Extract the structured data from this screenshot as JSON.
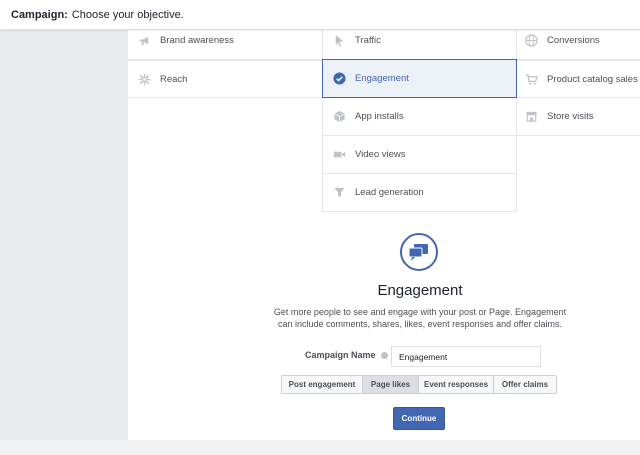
{
  "header": {
    "bold": "Campaign:",
    "text": "Choose your objective."
  },
  "objectives": {
    "brand_awareness": "Brand awareness",
    "reach": "Reach",
    "traffic": "Traffic",
    "engagement": "Engagement",
    "app_installs": "App installs",
    "video_views": "Video views",
    "lead_generation": "Lead generation",
    "conversions": "Conversions",
    "product_catalog_sales": "Product catalog sales",
    "store_visits": "Store visits"
  },
  "detail": {
    "title": "Engagement",
    "description": "Get more people to see and engage with your post or Page. Engagement can include comments, shares, likes, event responses and offer claims.",
    "campaign_name_label": "Campaign Name",
    "campaign_name_value": "Engagement",
    "options": [
      "Post engagement",
      "Page likes",
      "Event responses",
      "Offer claims"
    ],
    "selected_option": "Page likes",
    "continue_label": "Continue"
  },
  "colors": {
    "accent": "#4267b2",
    "icon_gray": "#bec2c9"
  }
}
